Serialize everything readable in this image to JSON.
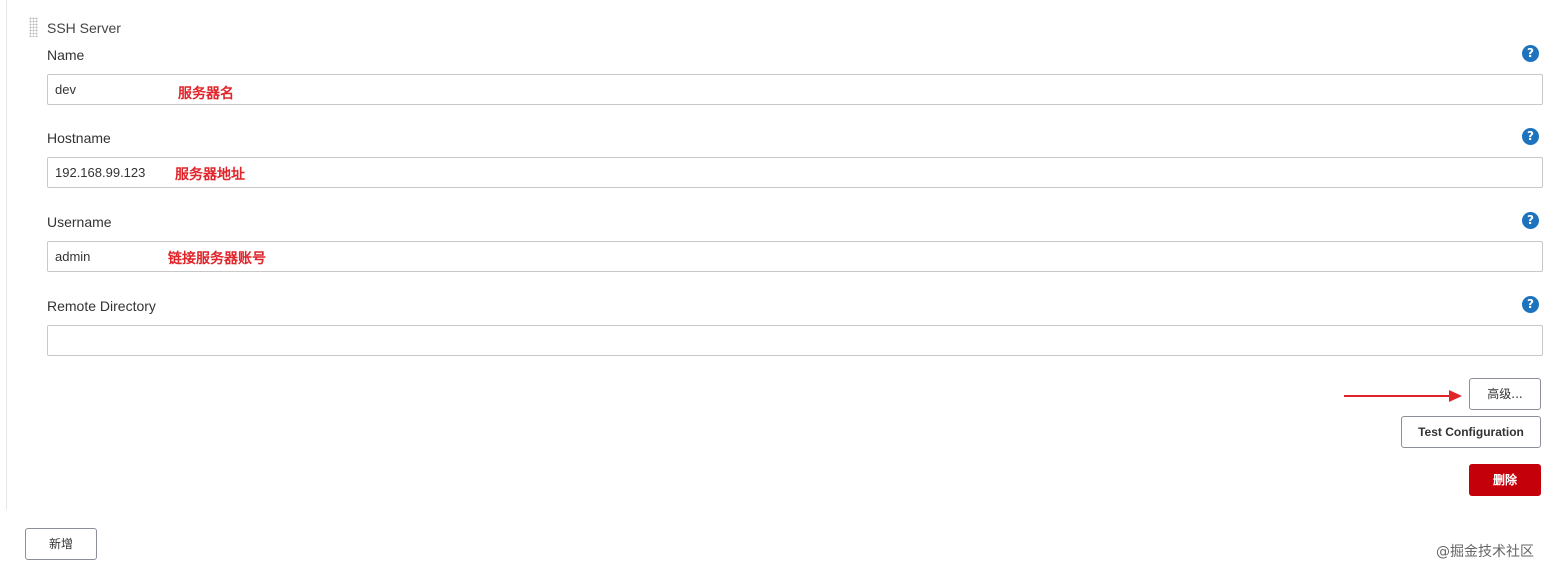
{
  "section": {
    "title": "SSH Server"
  },
  "fields": {
    "name": {
      "label": "Name",
      "value": "dev",
      "annotation": "服务器名"
    },
    "hostname": {
      "label": "Hostname",
      "value": "192.168.99.123",
      "annotation": "服务器地址"
    },
    "username": {
      "label": "Username",
      "value": "admin",
      "annotation": "链接服务器账号"
    },
    "remote_directory": {
      "label": "Remote Directory",
      "value": ""
    }
  },
  "help_icon": {
    "glyph": "?",
    "icon": "help-icon",
    "color": "#1e73be"
  },
  "buttons": {
    "advanced": "高级...",
    "test_configuration": "Test Configuration",
    "delete": "删除",
    "add": "新增"
  },
  "colors": {
    "annotation": "#e0242a",
    "delete_button": "#c4000a"
  },
  "watermark": "@掘金技术社区"
}
